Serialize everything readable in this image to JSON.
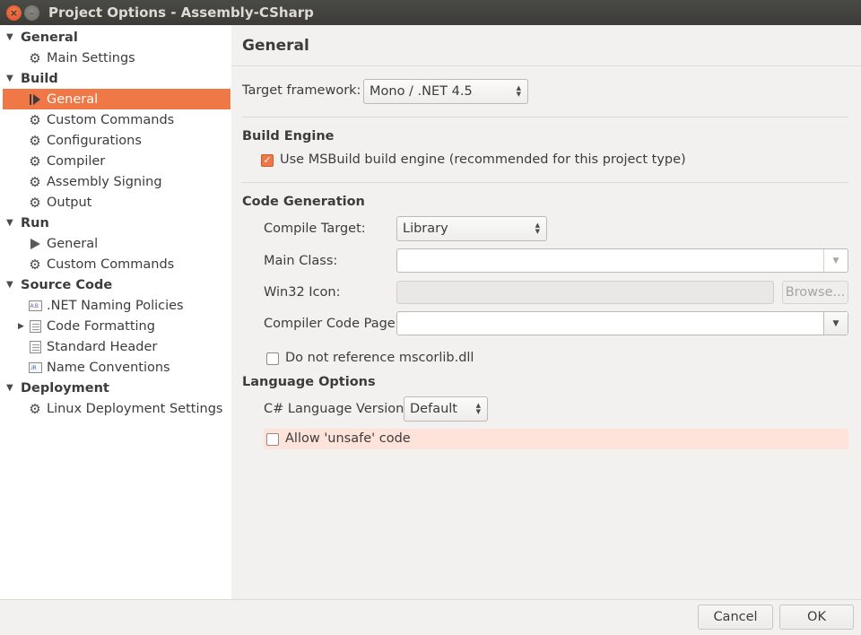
{
  "window": {
    "title": "Project Options - Assembly-CSharp",
    "close_glyph": "×",
    "minimize_glyph": "–"
  },
  "sidebar": {
    "rows": [
      {
        "kind": "category",
        "label": "General",
        "expanded": true
      },
      {
        "kind": "item",
        "label": "Main Settings",
        "icon": "gear-icon"
      },
      {
        "kind": "category",
        "label": "Build",
        "expanded": true
      },
      {
        "kind": "item",
        "label": "General",
        "icon": "run-icon",
        "selected": true
      },
      {
        "kind": "item",
        "label": "Custom Commands",
        "icon": "gear-icon"
      },
      {
        "kind": "item",
        "label": "Configurations",
        "icon": "gear-icon"
      },
      {
        "kind": "item",
        "label": "Compiler",
        "icon": "gear-icon"
      },
      {
        "kind": "item",
        "label": "Assembly Signing",
        "icon": "gear-icon"
      },
      {
        "kind": "item",
        "label": "Output",
        "icon": "gear-icon"
      },
      {
        "kind": "category",
        "label": "Run",
        "expanded": true
      },
      {
        "kind": "item",
        "label": "General",
        "icon": "play-icon"
      },
      {
        "kind": "item",
        "label": "Custom Commands",
        "icon": "gear-icon"
      },
      {
        "kind": "category",
        "label": "Source Code",
        "expanded": true
      },
      {
        "kind": "item",
        "label": ".NET Naming Policies",
        "icon": "naming-policy-icon"
      },
      {
        "kind": "item",
        "label": "Code Formatting",
        "icon": "document-icon",
        "collapsed_child": true
      },
      {
        "kind": "item",
        "label": "Standard Header",
        "icon": "document-icon"
      },
      {
        "kind": "item",
        "label": "Name Conventions",
        "icon": "name-convention-icon"
      },
      {
        "kind": "category",
        "label": "Deployment",
        "expanded": true
      },
      {
        "kind": "item",
        "label": "Linux Deployment Settings",
        "icon": "gear-icon"
      }
    ]
  },
  "panel": {
    "title": "General",
    "target_framework": {
      "label": "Target framework:",
      "value": "Mono / .NET 4.5"
    },
    "build_engine": {
      "heading": "Build Engine",
      "use_msbuild": {
        "label": "Use MSBuild build engine (recommended for this project type)",
        "checked": true
      }
    },
    "code_generation": {
      "heading": "Code Generation",
      "compile_target": {
        "label": "Compile Target:",
        "value": "Library"
      },
      "main_class": {
        "label": "Main Class:",
        "value": ""
      },
      "win32_icon": {
        "label": "Win32 Icon:",
        "value": "",
        "browse_label": "Browse..."
      },
      "compiler_code_page": {
        "label": "Compiler Code Page:",
        "value": ""
      },
      "no_mscorlib": {
        "label": "Do not reference mscorlib.dll",
        "checked": false
      }
    },
    "language_options": {
      "heading": "Language Options",
      "csharp_version": {
        "label": "C# Language Version:",
        "value": "Default"
      },
      "allow_unsafe": {
        "label": "Allow 'unsafe' code",
        "checked": false
      }
    }
  },
  "footer": {
    "cancel_label": "Cancel",
    "ok_label": "OK"
  },
  "colors": {
    "accent": "#f07746",
    "titlebar": "#3c3b37",
    "highlight": "#fde3da"
  }
}
